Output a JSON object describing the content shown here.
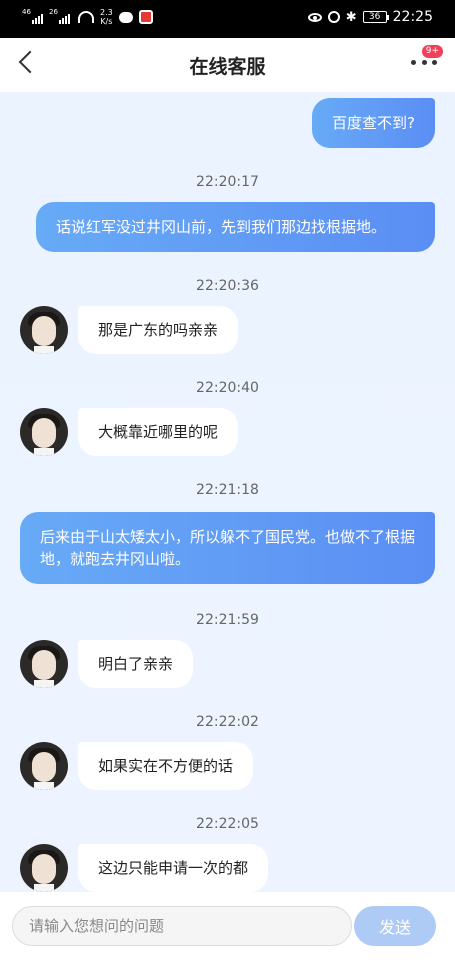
{
  "status_bar": {
    "signal1_label": "46",
    "signal2_label": "26",
    "speed_value": "2.3",
    "speed_unit": "K/s",
    "battery": "36",
    "time": "22:25"
  },
  "header": {
    "title": "在线客服",
    "badge": "9+"
  },
  "messages": [
    {
      "type": "out",
      "text": "百度查不到?"
    },
    {
      "type": "time",
      "text": "22:20:17"
    },
    {
      "type": "out",
      "text": "话说红军没过井冈山前，先到我们那边找根据地。"
    },
    {
      "type": "time",
      "text": "22:20:36"
    },
    {
      "type": "in",
      "text": "那是广东的吗亲亲"
    },
    {
      "type": "time",
      "text": "22:20:40"
    },
    {
      "type": "in",
      "text": "大概靠近哪里的呢"
    },
    {
      "type": "time",
      "text": "22:21:18"
    },
    {
      "type": "out",
      "text": "后来由于山太矮太小，所以躲不了国民党。也做不了根据地，就跑去井冈山啦。"
    },
    {
      "type": "time",
      "text": "22:21:59"
    },
    {
      "type": "in",
      "text": "明白了亲亲"
    },
    {
      "type": "time",
      "text": "22:22:02"
    },
    {
      "type": "in",
      "text": "如果实在不方便的话"
    },
    {
      "type": "time",
      "text": "22:22:05"
    },
    {
      "type": "in",
      "text": "这边只能申请一次的都"
    }
  ],
  "input": {
    "placeholder": "请输入您想问的问题",
    "send_label": "发送"
  }
}
